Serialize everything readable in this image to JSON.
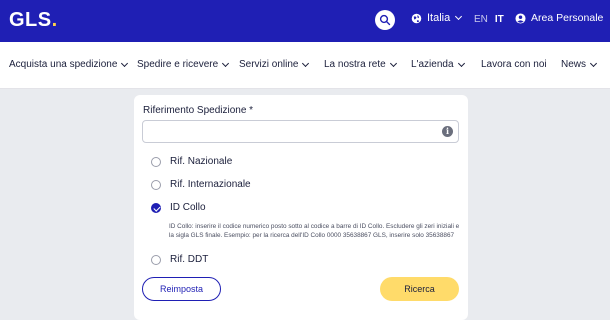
{
  "header": {
    "logo_text": "GLS",
    "logo_dot": ".",
    "country": "Italia",
    "lang_en": "EN",
    "lang_it": "IT",
    "account": "Area Personale",
    "colors": {
      "bar": "#1f1fb4",
      "accent": "#ffd24a"
    }
  },
  "nav": {
    "items": [
      {
        "label": "Acquista una spedizione"
      },
      {
        "label": "Spedire e ricevere"
      },
      {
        "label": "Servizi online"
      },
      {
        "label": "La nostra rete"
      },
      {
        "label": "L'azienda"
      },
      {
        "label": "Lavora con noi"
      },
      {
        "label": "News"
      }
    ]
  },
  "form": {
    "field_label": "Riferimento Spedizione *",
    "input_value": "",
    "info_glyph": "i",
    "options": [
      {
        "label": "Rif. Nazionale",
        "checked": false
      },
      {
        "label": "Rif. Internazionale",
        "checked": false
      },
      {
        "label": "ID Collo",
        "checked": true
      },
      {
        "label": "Rif. DDT",
        "checked": false
      }
    ],
    "id_collo_hint": "ID Collo: inserire il codice numerico posto sotto al codice a barre di ID Collo. Escludere gli zeri iniziali e la sigla GLS finale. Esempio: per la ricerca dell'ID Collo 0000 35638867 GLS, inserire solo 35638867",
    "reset_label": "Reimposta",
    "search_label": "Ricerca"
  }
}
